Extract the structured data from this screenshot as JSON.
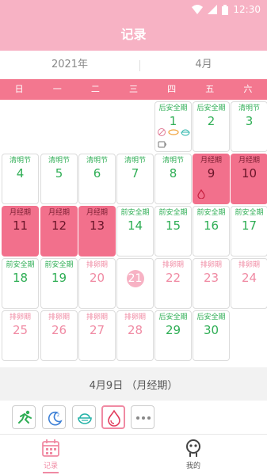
{
  "status": {
    "time": "12:30"
  },
  "header": {
    "title": "记录"
  },
  "month_picker": {
    "year": "2021年",
    "month": "4月"
  },
  "weekdays": [
    "日",
    "一",
    "二",
    "三",
    "四",
    "五",
    "六"
  ],
  "calendar": {
    "cells": [
      {
        "day": "1",
        "tag": "后安全期",
        "style": "green",
        "icons": true
      },
      {
        "day": "2",
        "tag": "后安全期",
        "style": "green"
      },
      {
        "day": "3",
        "tag": "清明节",
        "style": "green"
      },
      {
        "day": "4",
        "tag": "清明节",
        "style": "green"
      },
      {
        "day": "5",
        "tag": "清明节",
        "style": "green"
      },
      {
        "day": "6",
        "tag": "清明节",
        "style": "green"
      },
      {
        "day": "7",
        "tag": "清明节",
        "style": "green"
      },
      {
        "day": "8",
        "tag": "清明节",
        "style": "green"
      },
      {
        "day": "9",
        "tag": "月经期",
        "style": "period",
        "drop": true
      },
      {
        "day": "10",
        "tag": "月经期",
        "style": "period"
      },
      {
        "day": "11",
        "tag": "月经期",
        "style": "period"
      },
      {
        "day": "12",
        "tag": "月经期",
        "style": "period"
      },
      {
        "day": "13",
        "tag": "月经期",
        "style": "period"
      },
      {
        "day": "14",
        "tag": "前安全期",
        "style": "green"
      },
      {
        "day": "15",
        "tag": "前安全期",
        "style": "green"
      },
      {
        "day": "16",
        "tag": "前安全期",
        "style": "green"
      },
      {
        "day": "17",
        "tag": "前安全期",
        "style": "green"
      },
      {
        "day": "18",
        "tag": "前安全期",
        "style": "green"
      },
      {
        "day": "19",
        "tag": "前安全期",
        "style": "green"
      },
      {
        "day": "20",
        "tag": "排卵期",
        "style": "pink"
      },
      {
        "day": "21",
        "tag": "",
        "style": "today"
      },
      {
        "day": "22",
        "tag": "排卵期",
        "style": "pink"
      },
      {
        "day": "23",
        "tag": "排卵期",
        "style": "pink"
      },
      {
        "day": "24",
        "tag": "排卵期",
        "style": "pink"
      },
      {
        "day": "25",
        "tag": "排卵期",
        "style": "pink"
      },
      {
        "day": "26",
        "tag": "排卵期",
        "style": "pink"
      },
      {
        "day": "27",
        "tag": "排卵期",
        "style": "pink"
      },
      {
        "day": "28",
        "tag": "排卵期",
        "style": "pink"
      },
      {
        "day": "29",
        "tag": "后安全期",
        "style": "green"
      },
      {
        "day": "30",
        "tag": "后安全期",
        "style": "green"
      }
    ]
  },
  "selected_date": {
    "text": "4月9日  （月经期）"
  },
  "actions": [
    {
      "name": "exercise-icon"
    },
    {
      "name": "sleep-icon"
    },
    {
      "name": "diet-icon"
    },
    {
      "name": "period-icon",
      "active": true
    },
    {
      "name": "more-icon"
    }
  ],
  "tabbar": {
    "records": "记录",
    "mine": "我的"
  },
  "colors": {
    "brand": "#f7b2c4",
    "week_bar": "#f3778f",
    "period": "#f2708c",
    "safe": "#2fae55",
    "ovulation": "#f08aa3"
  }
}
